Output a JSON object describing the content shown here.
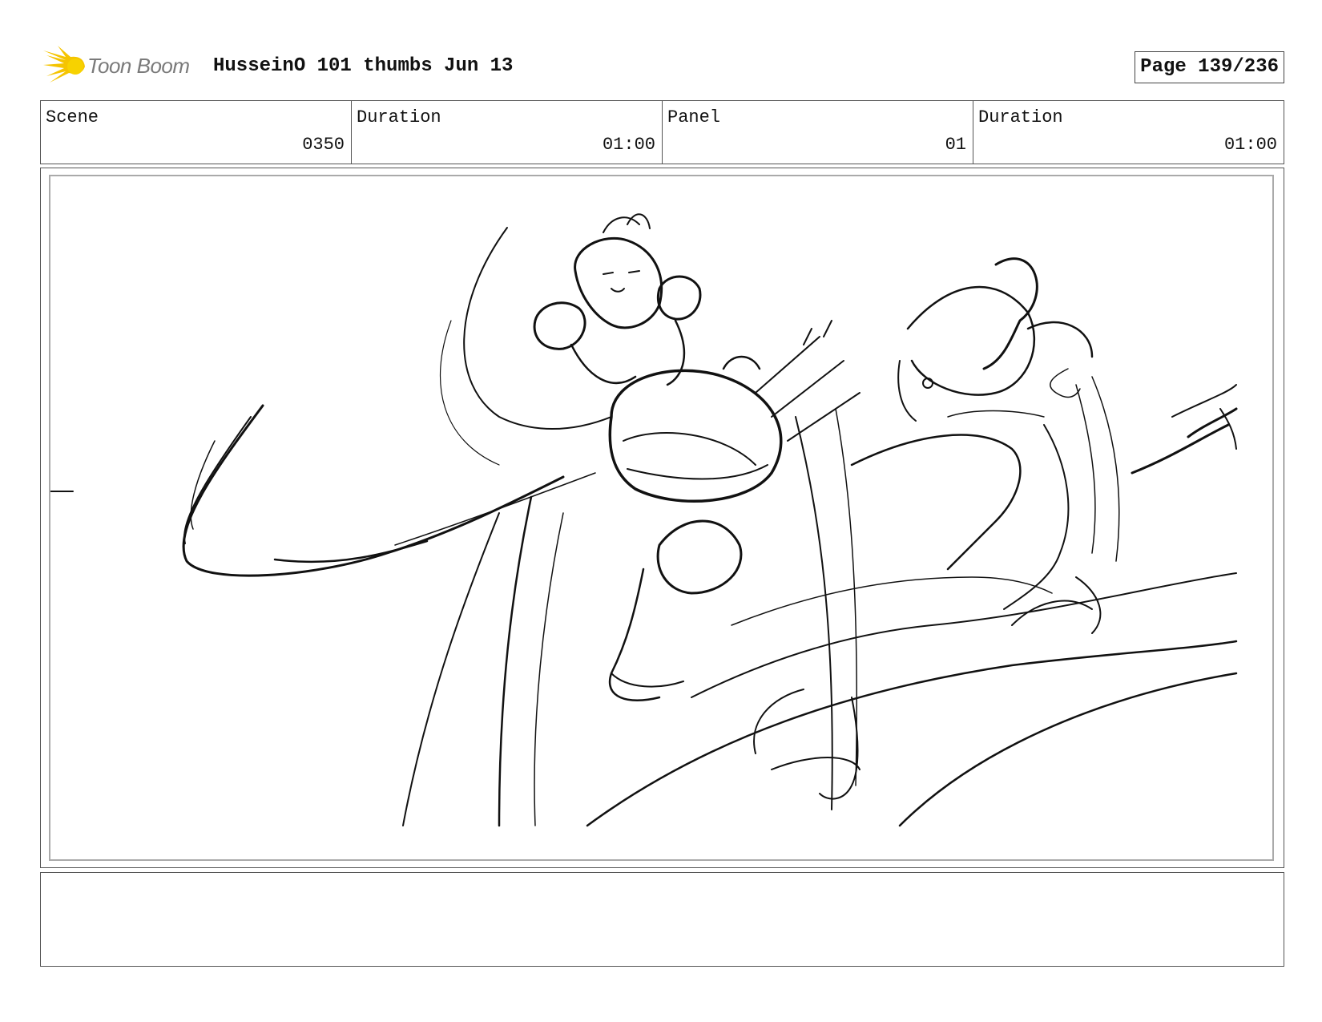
{
  "header": {
    "logo_text": "Toon Boom",
    "title": "HusseinO 101 thumbs Jun 13",
    "page": "Page 139/236"
  },
  "info": [
    {
      "label": "Scene",
      "value": "0350"
    },
    {
      "label": "Duration",
      "value": "01:00"
    },
    {
      "label": "Panel",
      "value": "01"
    },
    {
      "label": "Duration",
      "value": "01:00"
    }
  ],
  "notes": ""
}
